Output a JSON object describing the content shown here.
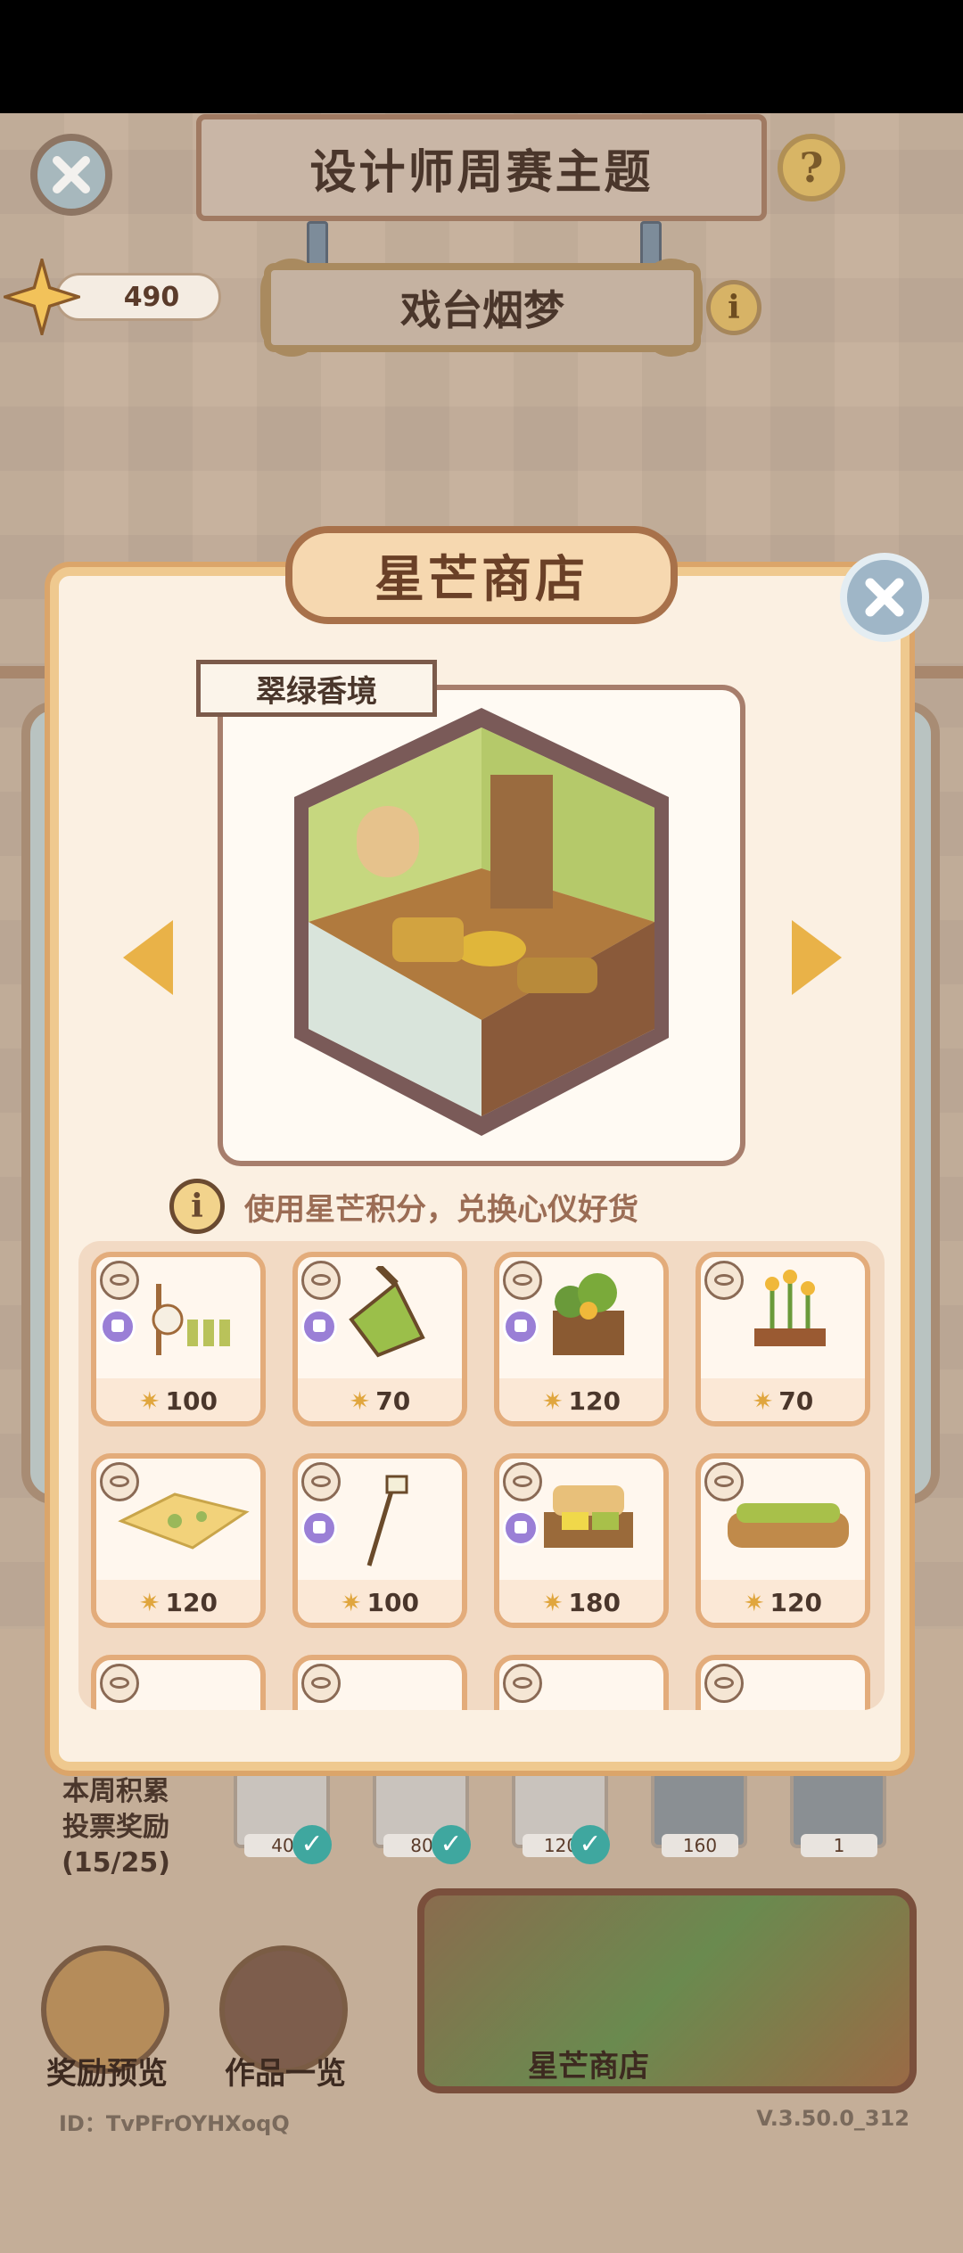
{
  "header": {
    "title": "设计师周赛主题",
    "theme_name": "戏台烟梦",
    "score": "490",
    "help_glyph": "?",
    "info_glyph": "i"
  },
  "modal": {
    "title": "星芒商店",
    "preview_name": "翠绿香境",
    "hint_glyph": "i",
    "hint_text": "使用星芒积分，兑换心仪好货",
    "items": [
      {
        "price": "100",
        "tagged": true
      },
      {
        "price": "70",
        "tagged": true
      },
      {
        "price": "120",
        "tagged": true
      },
      {
        "price": "70",
        "tagged": false
      },
      {
        "price": "120",
        "tagged": false
      },
      {
        "price": "100",
        "tagged": true
      },
      {
        "price": "180",
        "tagged": true
      },
      {
        "price": "120",
        "tagged": false
      }
    ]
  },
  "bottom": {
    "vote_reward_label_line1": "本周积累",
    "vote_reward_label_line2": "投票奖励",
    "vote_reward_progress": "(15/25)",
    "milestones": [
      "40",
      "80",
      "120",
      "160",
      "1"
    ],
    "reward_preview_label": "奖励预览",
    "works_list_label": "作品一览",
    "shop_label": "星芒商店",
    "player_id": "ID：TvPFrOYHXoqQ",
    "version": "V.3.50.0_312"
  },
  "colors": {
    "accent_gold": "#e9b248",
    "modal_border": "#efc98f",
    "card_border": "#e3ac7b"
  }
}
